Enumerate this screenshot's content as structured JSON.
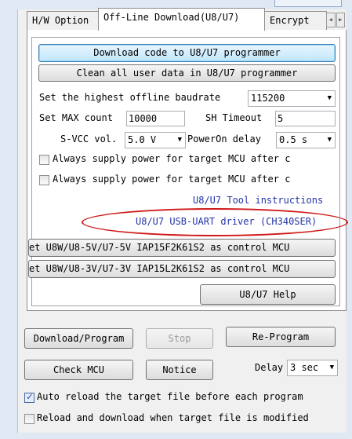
{
  "tabs": [
    {
      "label": "H/W Option"
    },
    {
      "label": "Off-Line Download(U8/U7)"
    },
    {
      "label": "Encrypt"
    }
  ],
  "offline": {
    "download_btn": "Download code to U8/U7 programmer",
    "clean_btn": "Clean all user data in U8/U7 programmer",
    "baudrate_label": "Set the highest offline baudrate",
    "baudrate_value": "115200",
    "max_count_label": "Set MAX count",
    "max_count_value": "10000",
    "sh_timeout_label": "SH Timeout",
    "sh_timeout_value": "5",
    "svcc_label": "S-VCC vol.",
    "svcc_value": "5.0 V",
    "poweron_label": "PowerOn delay",
    "poweron_value": "0.5 s",
    "always_supply_1": "Always supply power for target MCU after c",
    "always_supply_2": "Always supply power for target MCU after c",
    "tool_link": "U8/U7 Tool instructions",
    "driver_link": "U8/U7 USB-UART driver (CH340SER)",
    "set5v_btn": "et U8W/U8-5V/U7-5V IAP15F2K61S2 as control MCU",
    "set3v_btn": "et U8W/U8-3V/U7-3V IAP15L2K61S2 as control MCU",
    "help_btn": "U8/U7 Help"
  },
  "bottom": {
    "download_program": "Download/Program",
    "stop": "Stop",
    "reprogram": "Re-Program",
    "check_mcu": "Check MCU",
    "notice": "Notice",
    "delay_label": "Delay",
    "delay_value": "3 sec",
    "auto_reload": "Auto reload the target file before each program",
    "reload_modified": "Reload and download when target file is modified"
  },
  "state": {
    "always_supply_1_checked": false,
    "always_supply_2_checked": false,
    "auto_reload_checked": true,
    "reload_modified_checked": false
  },
  "colors": {
    "link": "#2334a6",
    "highlight_ellipse": "#d01818",
    "focus_button": "#bee6fd"
  }
}
